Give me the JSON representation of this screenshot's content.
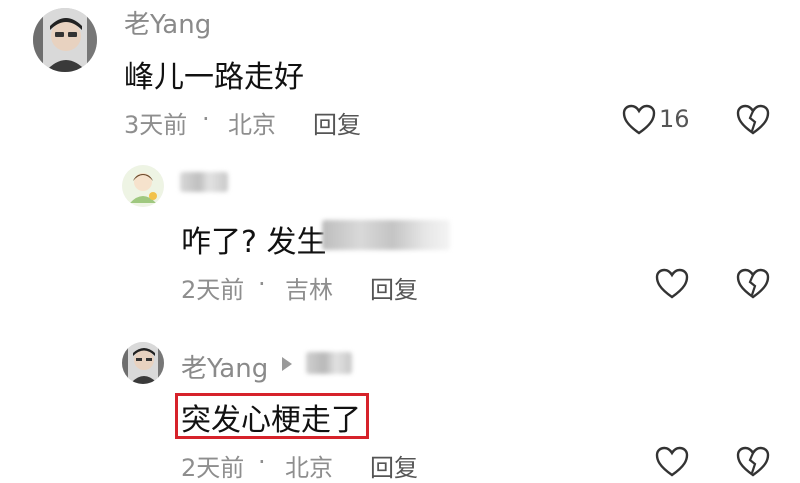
{
  "comments": [
    {
      "author": "老Yang",
      "text": "峰儿一路走好",
      "time": "3天前",
      "location": "北京",
      "reply_label": "回复",
      "likes": "16",
      "avatar": "avatar"
    },
    {
      "author": "",
      "text_visible": "咋了? 发生",
      "time": "2天前",
      "location": "吉林",
      "reply_label": "回复",
      "avatar": "avatar"
    },
    {
      "author": "老Yang",
      "text": "突发心梗走了",
      "time": "2天前",
      "location": "北京",
      "reply_label": "回复",
      "avatar": "avatar"
    }
  ],
  "separator": "·",
  "icons": [
    "heart-icon",
    "broken-heart-icon",
    "reply-arrow-icon"
  ],
  "colors": {
    "highlight": "#d6222a",
    "meta": "#8e8e8e",
    "text": "#111111"
  }
}
